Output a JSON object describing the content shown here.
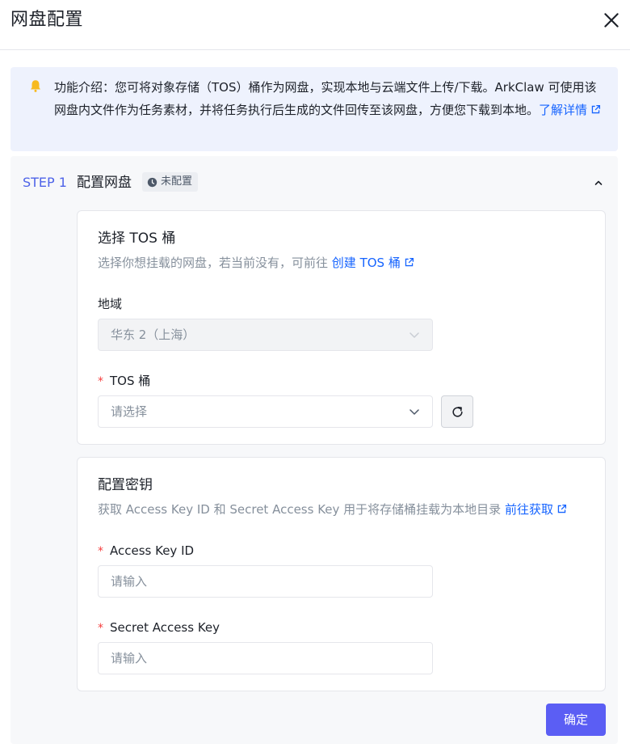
{
  "dialog": {
    "title": "网盘配置",
    "close_icon": "close-icon"
  },
  "notice": {
    "icon": "bell-icon",
    "text": "功能介绍：您可将对象存储（TOS）桶作为网盘，实现本地与云端文件上传/下载。ArkClaw 可使用该网盘内文件作为任务素材，并将任务执行后生成的文件回传至该网盘，方便您下载到本地。",
    "link_label": "了解详情"
  },
  "step": {
    "label": "STEP 1",
    "name": "配置网盘",
    "status": "未配置",
    "status_icon": "clock-icon",
    "collapse_icon": "chevron-up-icon"
  },
  "tos_card": {
    "title": "选择 TOS 桶",
    "desc": "选择你想挂载的网盘，若当前没有，可前往",
    "link_label": "创建 TOS 桶",
    "region_label": "地域",
    "region_value": "华东 2（上海）",
    "bucket_required": "*",
    "bucket_label": "TOS 桶",
    "bucket_placeholder": "请选择",
    "refresh_icon": "refresh-icon"
  },
  "key_card": {
    "title": "配置密钥",
    "desc": "获取 Access Key ID 和 Secret Access Key 用于将存储桶挂载为本地目录",
    "link_label": "前往获取",
    "ak_required": "*",
    "ak_label": "Access Key ID",
    "ak_placeholder": "请输入",
    "sk_required": "*",
    "sk_label": "Secret Access Key",
    "sk_placeholder": "请输入"
  },
  "footer": {
    "confirm_label": "确定"
  },
  "colors": {
    "accent": "#5b5ef4",
    "link": "#1664ff",
    "step": "#4e63e8",
    "required": "#f53f3f",
    "notice_bg": "#eef2fd"
  }
}
